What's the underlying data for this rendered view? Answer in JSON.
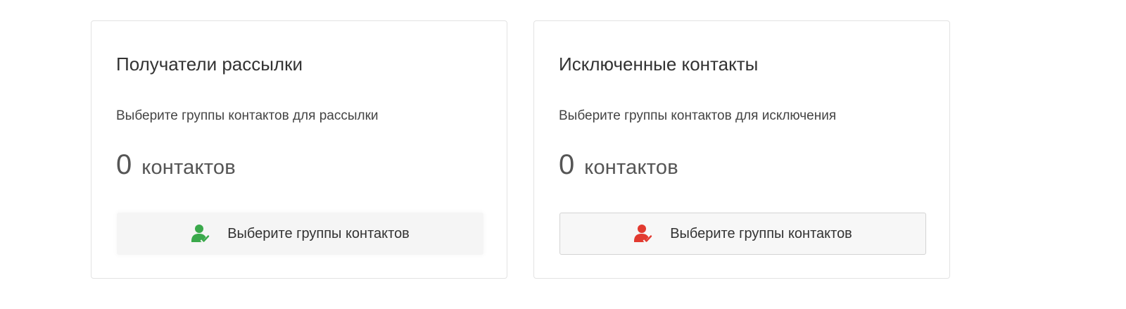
{
  "recipients_card": {
    "title": "Получатели рассылки",
    "subtitle": "Выберите группы контактов для рассылки",
    "count": "0",
    "count_label": "контактов",
    "button_label": "Выберите группы контактов",
    "icon": "user-check-icon",
    "icon_color": "#3aa94b"
  },
  "excluded_card": {
    "title": "Исключенные контакты",
    "subtitle": "Выберите группы контактов для исключения",
    "count": "0",
    "count_label": "контактов",
    "button_label": "Выберите группы контактов",
    "icon": "user-check-icon",
    "icon_color": "#e23a30"
  }
}
